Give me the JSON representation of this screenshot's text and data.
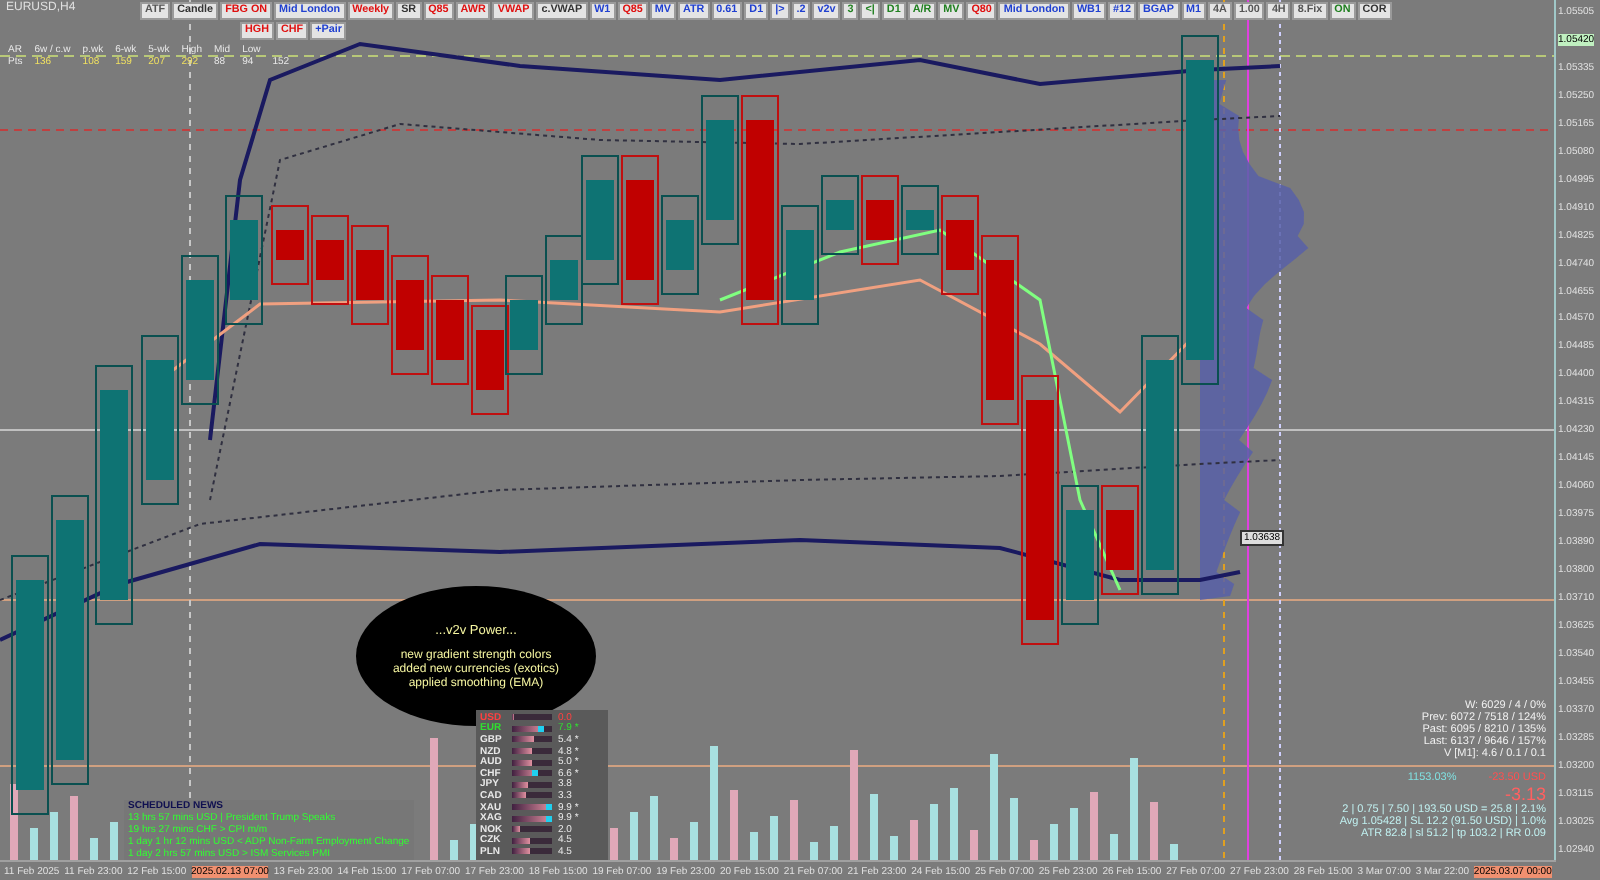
{
  "chart": {
    "symbol": "EURUSD,H4"
  },
  "toolbar": [
    {
      "label": "ATF",
      "color": "#555555"
    },
    {
      "label": "Candle",
      "color": "#333333"
    },
    {
      "label": "FBG ON",
      "color": "#e01010"
    },
    {
      "label": "Mid London",
      "color": "#2040d0"
    },
    {
      "label": "Weekly",
      "color": "#e01010"
    },
    {
      "label": "SR",
      "color": "#333333"
    },
    {
      "label": "Q85",
      "color": "#e01010"
    },
    {
      "label": "AWR",
      "color": "#e01010"
    },
    {
      "label": "VWAP",
      "color": "#e01010"
    },
    {
      "label": "c.VWAP",
      "color": "#333333"
    },
    {
      "label": "W1",
      "color": "#2040d0"
    },
    {
      "label": "Q85",
      "color": "#e01010"
    },
    {
      "label": "MV",
      "color": "#2040d0"
    },
    {
      "label": "ATR",
      "color": "#2040d0"
    },
    {
      "label": "0.61",
      "color": "#2040d0"
    },
    {
      "label": "D1",
      "color": "#2040d0"
    },
    {
      "label": "|>",
      "color": "#2040d0"
    },
    {
      "label": ".2",
      "color": "#2040d0"
    },
    {
      "label": "v2v",
      "color": "#2040d0"
    },
    {
      "label": "3",
      "color": "#208020"
    },
    {
      "label": "<|",
      "color": "#208020"
    },
    {
      "label": "D1",
      "color": "#208020"
    },
    {
      "label": "A/R",
      "color": "#208020"
    },
    {
      "label": "MV",
      "color": "#208020"
    },
    {
      "label": "Q80",
      "color": "#e01010"
    },
    {
      "label": "Mid London",
      "color": "#2040d0"
    },
    {
      "label": "WB1",
      "color": "#2040d0"
    },
    {
      "label": "#12",
      "color": "#2040d0"
    },
    {
      "label": "BGAP",
      "color": "#2040d0"
    },
    {
      "label": "M1",
      "color": "#2040d0"
    },
    {
      "label": "4A",
      "color": "#555555"
    },
    {
      "label": "1.00",
      "color": "#555555"
    },
    {
      "label": "4H",
      "color": "#555555"
    },
    {
      "label": "8.Fix",
      "color": "#555555"
    },
    {
      "label": "ON",
      "color": "#208020"
    },
    {
      "label": "COR",
      "color": "#333333"
    }
  ],
  "toolbar_row2": [
    {
      "label": "HGH",
      "color": "#e01010"
    },
    {
      "label": "CHF",
      "color": "#e01010"
    },
    {
      "label": "+Pair",
      "color": "#2040d0"
    }
  ],
  "stats_table": {
    "headers": [
      "AR",
      "6w / c.w",
      "p.wk",
      "6-wk",
      "5-wk",
      "High",
      "Mid",
      "Low"
    ],
    "values": [
      "Pts",
      "136",
      "108",
      "159",
      "207",
      "292",
      "88",
      "94",
      "152"
    ]
  },
  "bubble": {
    "title": "...v2v Power...",
    "lines": [
      "new gradient strength colors",
      "added new currencies (exotics)",
      "applied smoothing (EMA)"
    ]
  },
  "strength": [
    {
      "currency": "USD",
      "value": "0.0",
      "level": 0.04,
      "color": "#ff4040"
    },
    {
      "currency": "EUR",
      "value": "7.9 *",
      "level": 0.79,
      "color": "#30e030"
    },
    {
      "currency": "GBP",
      "value": "5.4 *",
      "level": 0.54,
      "color": "#e8e8e8"
    },
    {
      "currency": "NZD",
      "value": "4.8 *",
      "level": 0.48,
      "color": "#e8e8e8"
    },
    {
      "currency": "AUD",
      "value": "5.0 *",
      "level": 0.5,
      "color": "#e8e8e8"
    },
    {
      "currency": "CHF",
      "value": "6.6 *",
      "level": 0.66,
      "color": "#e8e8e8"
    },
    {
      "currency": "JPY",
      "value": "3.8",
      "level": 0.38,
      "color": "#e8e8e8"
    },
    {
      "currency": "CAD",
      "value": "3.3",
      "level": 0.33,
      "color": "#e8e8e8"
    },
    {
      "currency": "XAU",
      "value": "9.9 *",
      "level": 0.99,
      "color": "#e8e8e8"
    },
    {
      "currency": "XAG",
      "value": "9.9 *",
      "level": 0.99,
      "color": "#e8e8e8"
    },
    {
      "currency": "NOK",
      "value": "2.0",
      "level": 0.2,
      "color": "#e8e8e8"
    },
    {
      "currency": "CZK",
      "value": "4.5",
      "level": 0.45,
      "color": "#e8e8e8"
    },
    {
      "currency": "PLN",
      "value": "4.5",
      "level": 0.45,
      "color": "#e8e8e8"
    }
  ],
  "news": {
    "title": "SCHEDULED NEWS",
    "items": [
      "13 hrs 57 mins  USD  |  President Trump Speaks",
      "19 hrs 27 mins  CHF  >  CPI m/m",
      "1 day 1 hr 12 mins  USD  <  ADP Non-Farm Employment Change",
      "1 day 2 hrs 57 mins  USD  >  ISM Services PMI"
    ]
  },
  "account": {
    "lines": [
      "W: 6029 / 4 / 0%",
      "Prev: 6072 / 7518 / 124%",
      "Past: 6095 / 8210 / 135%",
      "Last: 6137 / 9646 / 157%",
      "V [M1]: 4.6 / 0.1 / 0.1"
    ],
    "percent": "1153.03%",
    "pnl": "-23.50 USD",
    "pips": "-3.13",
    "details": [
      "2  |  0.75  |  7.50  |  193.50 USD = 25.8  |  2.1%",
      "Avg 1.05428  |  SL 12.2 (91.50 USD)  |  1.0%",
      "ATR 82.8  |  sl 51.2  |  tp 103.2  |  RR 0.09"
    ]
  },
  "price_tag": "1.03638",
  "price_axis": [
    {
      "label": "1.05505",
      "highlighted": false
    },
    {
      "label": "1.05420",
      "highlighted": true
    },
    {
      "label": "1.05335",
      "highlighted": false
    },
    {
      "label": "1.05250",
      "highlighted": false
    },
    {
      "label": "1.05165",
      "highlighted": false
    },
    {
      "label": "1.05080",
      "highlighted": false
    },
    {
      "label": "1.04995",
      "highlighted": false
    },
    {
      "label": "1.04910",
      "highlighted": false
    },
    {
      "label": "1.04825",
      "highlighted": false
    },
    {
      "label": "1.04740",
      "highlighted": false
    },
    {
      "label": "1.04655",
      "highlighted": false
    },
    {
      "label": "1.04570",
      "highlighted": false
    },
    {
      "label": "1.04485",
      "highlighted": false
    },
    {
      "label": "1.04400",
      "highlighted": false
    },
    {
      "label": "1.04315",
      "highlighted": false
    },
    {
      "label": "1.04230",
      "highlighted": false
    },
    {
      "label": "1.04145",
      "highlighted": false
    },
    {
      "label": "1.04060",
      "highlighted": false
    },
    {
      "label": "1.03975",
      "highlighted": false
    },
    {
      "label": "1.03890",
      "highlighted": false
    },
    {
      "label": "1.03800",
      "highlighted": false
    },
    {
      "label": "1.03710",
      "highlighted": false
    },
    {
      "label": "1.03625",
      "highlighted": false
    },
    {
      "label": "1.03540",
      "highlighted": false
    },
    {
      "label": "1.03455",
      "highlighted": false
    },
    {
      "label": "1.03370",
      "highlighted": false
    },
    {
      "label": "1.03285",
      "highlighted": false
    },
    {
      "label": "1.03200",
      "highlighted": false
    },
    {
      "label": "1.03115",
      "highlighted": false
    },
    {
      "label": "1.03025",
      "highlighted": false
    },
    {
      "label": "1.02940",
      "highlighted": false
    }
  ],
  "time_axis": [
    {
      "label": "11 Feb 2025",
      "highlighted": false
    },
    {
      "label": "11 Feb 23:00",
      "highlighted": false
    },
    {
      "label": "12 Feb 15:00",
      "highlighted": false
    },
    {
      "label": "2025.02.13 07:00",
      "highlighted": true
    },
    {
      "label": "13 Feb 23:00",
      "highlighted": false
    },
    {
      "label": "14 Feb 15:00",
      "highlighted": false
    },
    {
      "label": "17 Feb 07:00",
      "highlighted": false
    },
    {
      "label": "17 Feb 23:00",
      "highlighted": false
    },
    {
      "label": "18 Feb 15:00",
      "highlighted": false
    },
    {
      "label": "19 Feb 07:00",
      "highlighted": false
    },
    {
      "label": "19 Feb 23:00",
      "highlighted": false
    },
    {
      "label": "20 Feb 15:00",
      "highlighted": false
    },
    {
      "label": "21 Feb 07:00",
      "highlighted": false
    },
    {
      "label": "21 Feb 23:00",
      "highlighted": false
    },
    {
      "label": "24 Feb 15:00",
      "highlighted": false
    },
    {
      "label": "25 Feb 07:00",
      "highlighted": false
    },
    {
      "label": "25 Feb 23:00",
      "highlighted": false
    },
    {
      "label": "26 Feb 15:00",
      "highlighted": false
    },
    {
      "label": "27 Feb 07:00",
      "highlighted": false
    },
    {
      "label": "27 Feb 23:00",
      "highlighted": false
    },
    {
      "label": "28 Feb 15:00",
      "highlighted": false
    },
    {
      "label": "3 Mar 07:00",
      "highlighted": false
    },
    {
      "label": "3 Mar 22:00",
      "highlighted": false
    },
    {
      "label": "2025.03.07 00:00",
      "highlighted": true
    }
  ]
}
